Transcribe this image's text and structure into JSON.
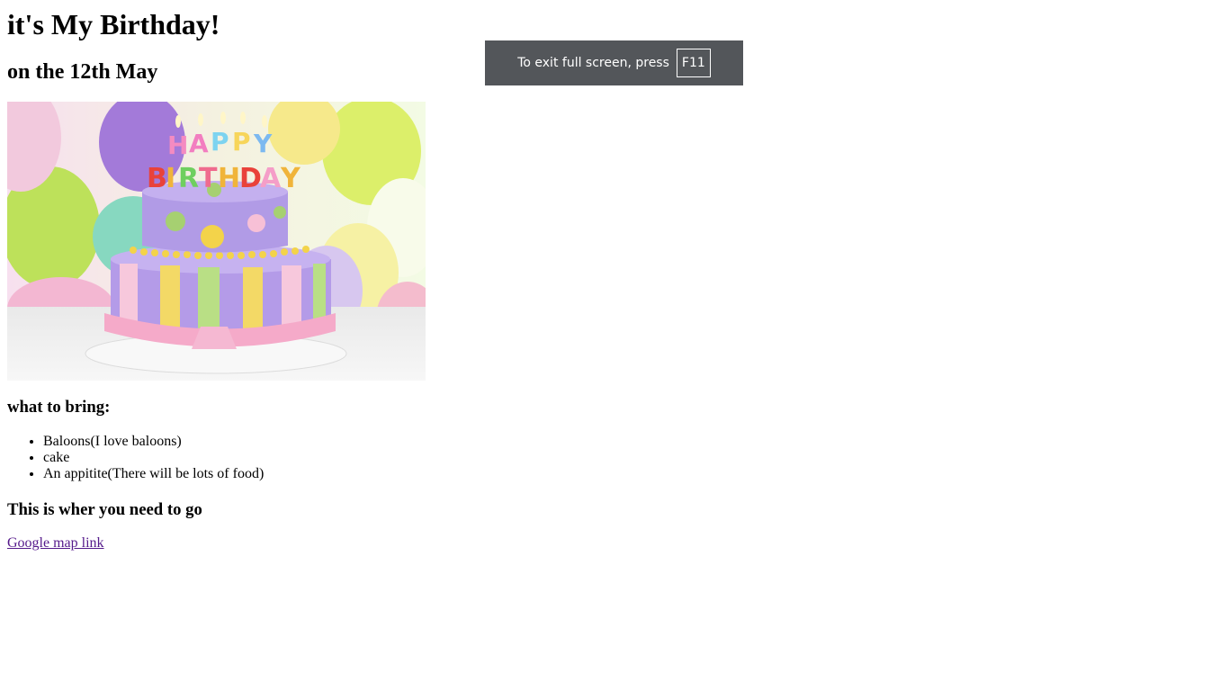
{
  "page": {
    "title": "it's My Birthday!",
    "subtitle": "on the 12th May"
  },
  "bring": {
    "heading": "what to bring:",
    "items": [
      "Baloons(I love baloons)",
      "cake",
      "An appitite(There will be lots of food)"
    ]
  },
  "location": {
    "heading": "This is wher you need to go",
    "link_label": "Google map link"
  },
  "fullscreen_toast": {
    "message": "To exit full screen, press",
    "key": "F11"
  },
  "colors": {
    "link": "#551a8b",
    "toast_bg": "#53565a"
  }
}
